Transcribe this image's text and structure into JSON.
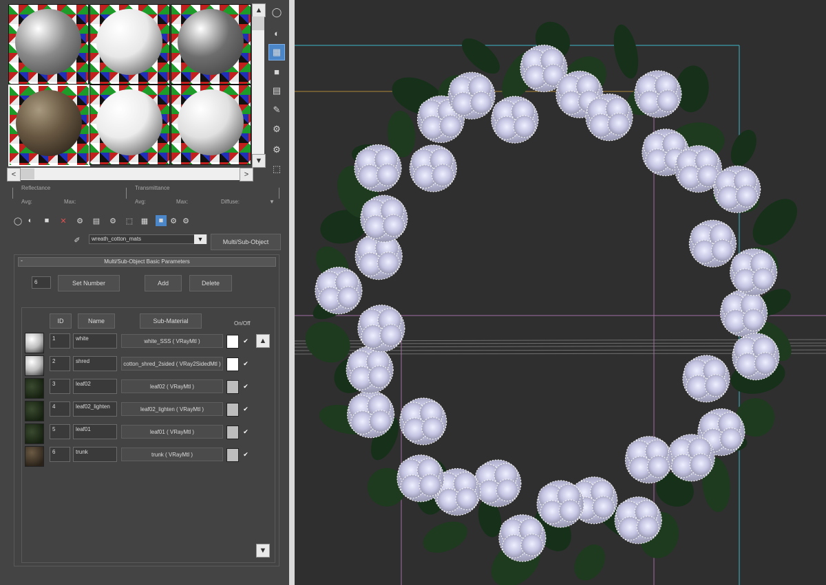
{
  "preview": {
    "slots": [
      {
        "material": "grey-sphere",
        "sphere_color": "#8a8a8a"
      },
      {
        "material": "white-sphere",
        "sphere_color": "#e8e8e8"
      },
      {
        "material": "dark-grey-sphere",
        "sphere_color": "#6e6e6e"
      },
      {
        "material": "textured-sphere",
        "sphere_color": "#6b5a44"
      },
      {
        "material": "white-sphere",
        "sphere_color": "#ececec"
      },
      {
        "material": "white-sphere",
        "sphere_color": "#e0e0e0"
      }
    ],
    "reflectance_label": "Reflectance",
    "transmittance_label": "Transmittance",
    "avg_label": "Avg:",
    "max_label": "Max:",
    "avg2_label": "Avg:",
    "max2_label": "Max:",
    "diffuse_label": "Diffuse:"
  },
  "material": {
    "name": "wreath_cotton_mats",
    "type_button": "Multi/Sub-Object"
  },
  "rollout": {
    "title": "Multi/Sub-Object Basic Parameters",
    "collapse_symbol": "-",
    "count": "6",
    "set_number_label": "Set Number",
    "add_label": "Add",
    "delete_label": "Delete",
    "col_id": "ID",
    "col_name": "Name",
    "col_submaterial": "Sub-Material",
    "col_onoff": "On/Off"
  },
  "rows": [
    {
      "id": "1",
      "name": "white",
      "submaterial": "white_SSS  ( VRayMtl )",
      "swatch": "#ffffff",
      "on": "✔"
    },
    {
      "id": "2",
      "name": "shred",
      "submaterial": "cotton_shred_2sided  ( VRay2SidedMtl )",
      "swatch": "#ffffff",
      "on": "✔"
    },
    {
      "id": "3",
      "name": "leaf02",
      "submaterial": "leaf02  ( VRayMtl )",
      "swatch": "#bdbdbd",
      "on": "✔"
    },
    {
      "id": "4",
      "name": "leaf02_lighten",
      "submaterial": "leaf02_lighten  ( VRayMtl )",
      "swatch": "#bdbdbd",
      "on": "✔"
    },
    {
      "id": "5",
      "name": "leaf01",
      "submaterial": "leaf01  ( VRayMtl )",
      "swatch": "#bdbdbd",
      "on": "✔"
    },
    {
      "id": "6",
      "name": "trunk",
      "submaterial": "trunk  ( VRayMtl )",
      "swatch": "#bdbdbd",
      "on": "✔"
    }
  ],
  "icons": {
    "sphere": "◯",
    "backlight": "◐",
    "checker": "▦",
    "square": "■",
    "gradient": "▤",
    "eyedrop": "✎",
    "options": "⚙",
    "select": "⬚",
    "close": "✕",
    "up": "▲",
    "down": "▼",
    "left": "<",
    "right": ">",
    "dropdown": "▼",
    "pick": "✐"
  },
  "colors": {
    "panel": "#444444",
    "accent": "#4a86c8",
    "viewport": "#2f2f2f",
    "flower": "#c8c8e4",
    "leaf": "#1e3a1f"
  }
}
